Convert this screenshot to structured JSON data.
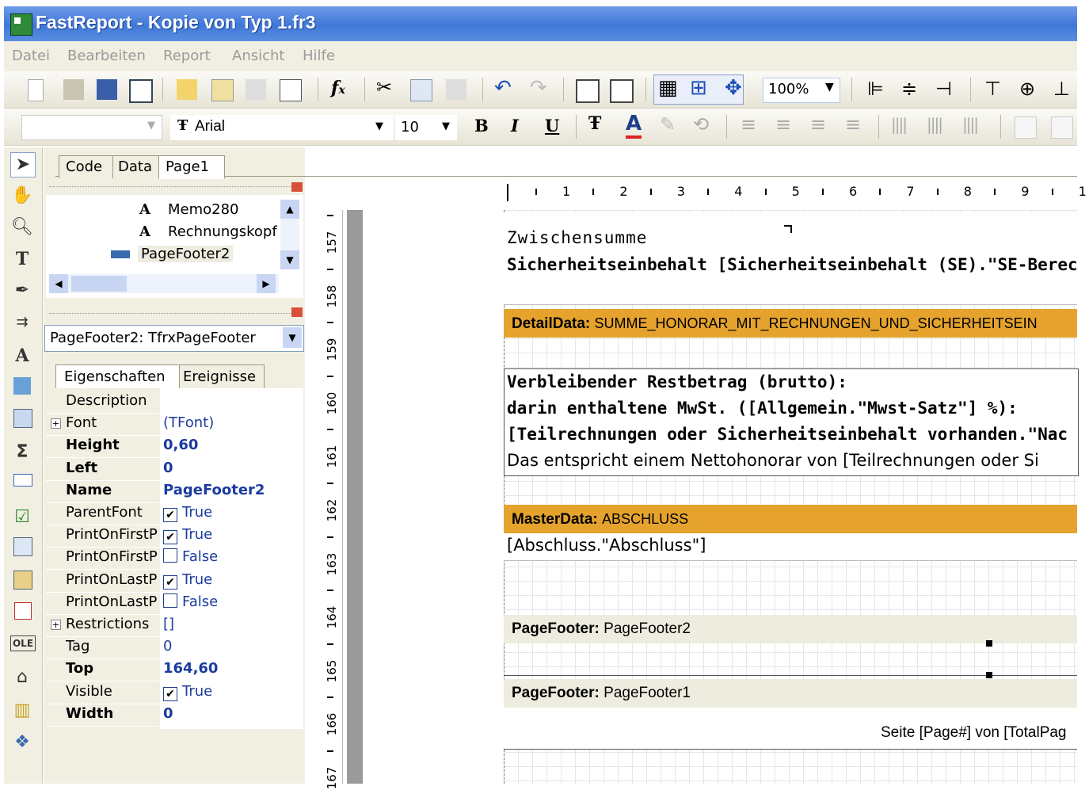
{
  "window": {
    "title": "FastReport - Kopie von Typ 1.fr3"
  },
  "menu": [
    "Datei",
    "Bearbeiten",
    "Report",
    "Ansicht",
    "Hilfe"
  ],
  "toolbar": {
    "zoom": "100%",
    "font_name": "Arial",
    "font_size": "10",
    "bold": "B",
    "italic": "I",
    "underline": "U"
  },
  "tabs": [
    "Code",
    "Data",
    "Page1"
  ],
  "tree": {
    "items": [
      "Memo280",
      "Rechnungskopf",
      "PageFooter2"
    ]
  },
  "object_selector": "PageFooter2: TfrxPageFooter",
  "inspector_tabs": [
    "Eigenschaften",
    "Ereignisse"
  ],
  "properties": [
    {
      "name": "Description",
      "value": ""
    },
    {
      "name": "Font",
      "value": "(TFont)"
    },
    {
      "name": "Height",
      "value": "0,60"
    },
    {
      "name": "Left",
      "value": "0"
    },
    {
      "name": "Name",
      "value": "PageFooter2"
    },
    {
      "name": "ParentFont",
      "value": "True"
    },
    {
      "name": "PrintOnFirstP",
      "value": "True"
    },
    {
      "name": "PrintOnFirstP",
      "value": "False"
    },
    {
      "name": "PrintOnLastP",
      "value": "True"
    },
    {
      "name": "PrintOnLastP",
      "value": "False"
    },
    {
      "name": "Restrictions",
      "value": "[]"
    },
    {
      "name": "Tag",
      "value": "0"
    },
    {
      "name": "Top",
      "value": "164,60"
    },
    {
      "name": "Visible",
      "value": "True"
    },
    {
      "name": "Width",
      "value": "0"
    }
  ],
  "hruler": [
    "1",
    "2",
    "3",
    "4",
    "5",
    "6",
    "7",
    "8",
    "9",
    "1"
  ],
  "vruler": [
    "157",
    "158",
    "159",
    "160",
    "161",
    "162",
    "163",
    "164",
    "165",
    "166",
    "167"
  ],
  "report": {
    "memo1_a": "Zwischensumme",
    "memo1_b": "Sicherheitseinbehalt [Sicherheitseinbehalt (SE).\"SE-Berech",
    "band1_type": "DetailData:",
    "band1_name": "SUMME_HONORAR_MIT_RECHNUNGEN_UND_SICHERHEITSEIN",
    "memo2_a": "Verbleibender Restbetrag (brutto):",
    "memo2_b": "darin enthaltene MwSt. ([Allgemein.\"Mwst-Satz\"] %):",
    "memo2_c": "[Teilrechnungen oder Sicherheitseinbehalt vorhanden.\"Nac",
    "memo2_d": "Das entspricht einem Nettohonorar von [Teilrechnungen oder Si",
    "band2_type": "MasterData:",
    "band2_name": "ABSCHLUSS",
    "memo3": "[Abschluss.\"Abschluss\"]",
    "band3_type": "PageFooter:",
    "band3_name": "PageFooter2",
    "band4_type": "PageFooter:",
    "band4_name": "PageFooter1",
    "page_text": "Seite [Page#] von [TotalPag"
  }
}
